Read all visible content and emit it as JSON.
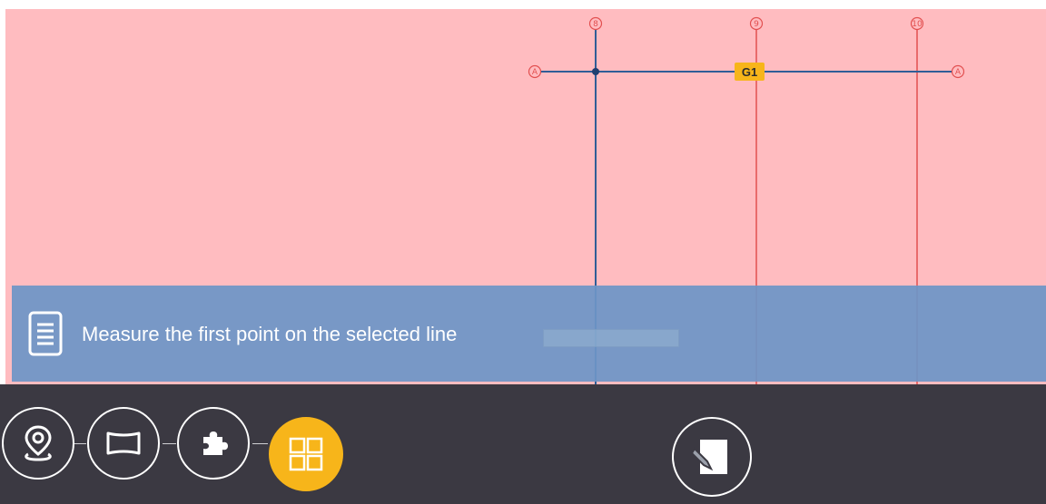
{
  "grid": {
    "vertical_lines": [
      {
        "label": "8",
        "color": "#2f5d97"
      },
      {
        "label": "9",
        "color": "#e25050"
      },
      {
        "label": "10",
        "color": "#e25050"
      }
    ],
    "horizontal_line": {
      "label_left": "A",
      "label_right": "A",
      "color": "#2f5d97"
    },
    "selected_tag": "G1",
    "colors": {
      "background": "#ffbcc0",
      "tag": "#f7b51a",
      "bubble": "#e25050"
    }
  },
  "instruction": {
    "icon": "document-icon",
    "text": "Measure the first point on the selected line"
  },
  "toolbar": {
    "buttons": [
      {
        "name": "location-pin-button",
        "icon": "location-pin-icon",
        "active": false
      },
      {
        "name": "view-frame-button",
        "icon": "view-frame-icon",
        "active": false
      },
      {
        "name": "plugin-button",
        "icon": "puzzle-icon",
        "active": false
      },
      {
        "name": "grid-layout-button",
        "icon": "grid-layout-icon",
        "active": true
      },
      {
        "name": "notes-button",
        "icon": "notepad-pencil-icon",
        "active": false
      }
    ],
    "colors": {
      "background": "#3b3942",
      "active": "#f7b51a"
    }
  }
}
